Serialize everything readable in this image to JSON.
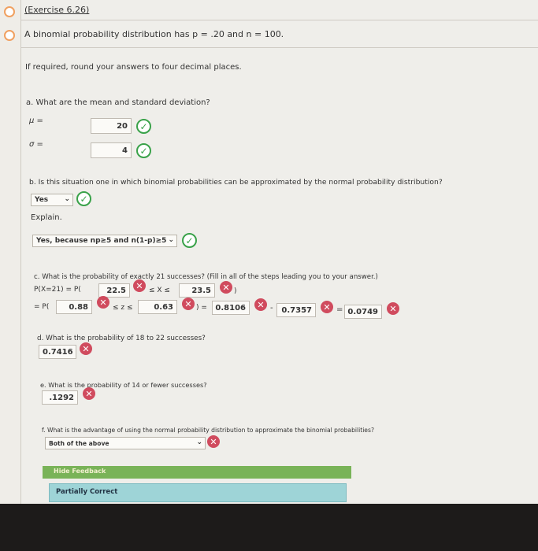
{
  "header": {
    "title": "(Exercise 6.26)"
  },
  "problem": {
    "statement": "A binomial probability distribution has p = .20 and n = 100.",
    "instruction": "If required, round your answers to four decimal places."
  },
  "part_a": {
    "question": "a. What are the mean and standard deviation?",
    "mu_label": "μ =",
    "mu_value": "20",
    "sigma_label": "σ =",
    "sigma_value": "4"
  },
  "part_b": {
    "question": "b. Is this situation one in which binomial probabilities can be approximated by the normal probability distribution?",
    "answer": "Yes",
    "explain_label": "Explain.",
    "explain_answer": "Yes, because np≥5 and n(1-p)≥5"
  },
  "part_c": {
    "question": "c. What is the probability of exactly 21 successes? (Fill in all of the steps leading you to your answer.)",
    "line1_prefix": "P(X=21) = P(",
    "lower_x": "22.5",
    "mid_text": "≤ X ≤",
    "upper_x": "23.5",
    "close_paren": ")",
    "line2_prefix": "= P(",
    "lower_z": "0.88",
    "z_mid": "≤ z ≤",
    "upper_z": "0.63",
    "close_eq": ") =",
    "p1": "0.8106",
    "minus": "-",
    "p2": "0.7357",
    "eq": "=",
    "result": "0.0749"
  },
  "part_d": {
    "question": "d. What is the probability of 18 to 22 successes?",
    "answer": "0.7416"
  },
  "part_e": {
    "question": "e. What is the probability of 14 or fewer successes?",
    "answer": ".1292"
  },
  "part_f": {
    "question": "f. What is the advantage of using the normal probability distribution to approximate the binomial probabilities?",
    "answer": "Both of the above"
  },
  "feedback": {
    "hide_label": "Hide Feedback",
    "status": "Partially Correct"
  },
  "icons": {
    "check": "✓",
    "cross": "✕",
    "chevron": "⌄"
  }
}
